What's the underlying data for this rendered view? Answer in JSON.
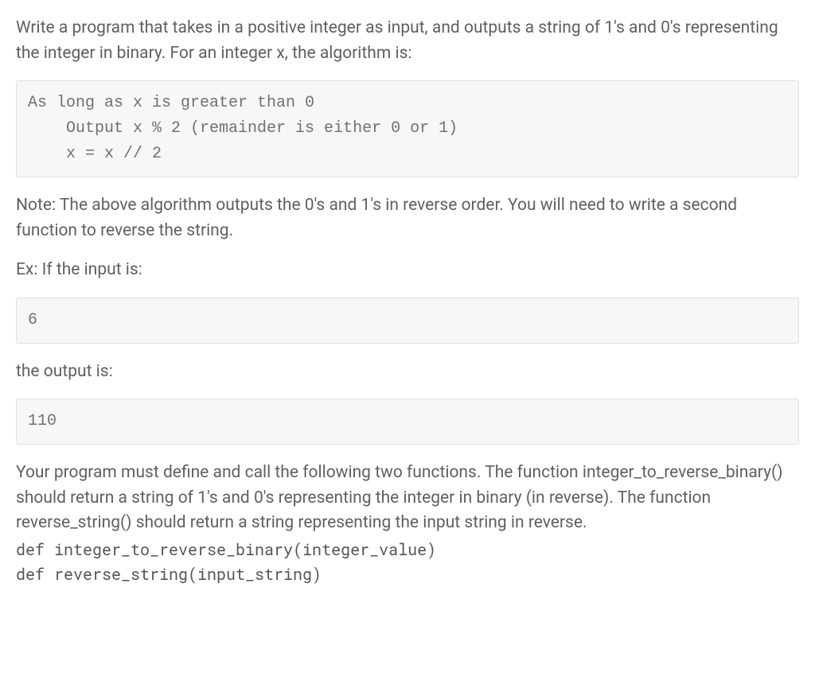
{
  "intro": "Write a program that takes in a positive integer as input, and outputs a string of 1's and 0's representing the integer in binary. For an integer x, the algorithm is:",
  "algorithm": "As long as x is greater than 0\n    Output x % 2 (remainder is either 0 or 1)\n    x = x // 2",
  "note": "Note: The above algorithm outputs the 0's and 1's in reverse order. You will need to write a second function to reverse the string.",
  "exInputLabel": "Ex: If the input is:",
  "exInput": "6",
  "outputLabel": "the output is:",
  "exOutput": "110",
  "requirements": "Your program must define and call the following two functions. The function integer_to_reverse_binary() should return a string of 1's and 0's representing the integer in binary (in reverse). The function reverse_string() should return a string representing the input string in reverse.",
  "funcDef1": "def integer_to_reverse_binary(integer_value)",
  "funcDef2": "def reverse_string(input_string)"
}
